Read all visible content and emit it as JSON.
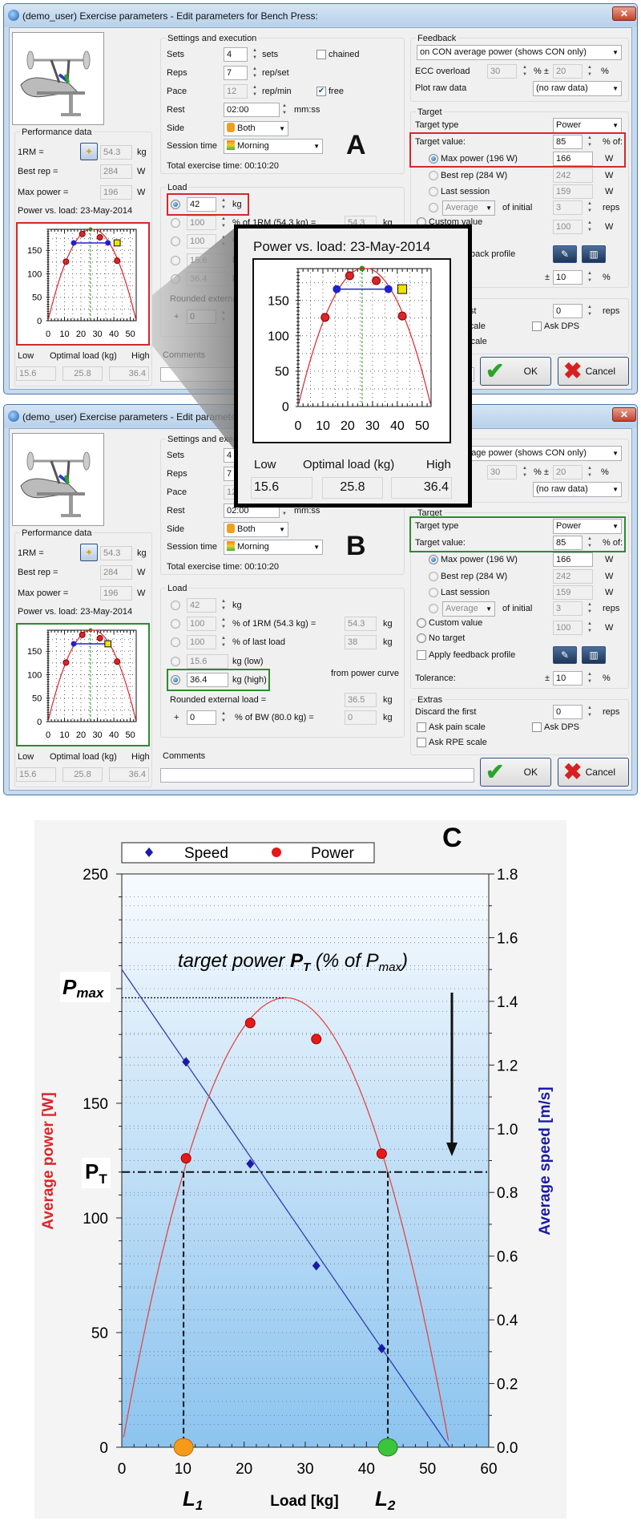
{
  "dialog": {
    "title": "(demo_user) Exercise parameters - Edit parameters for Bench Press:",
    "close_label": "✕",
    "perf": {
      "title": "Performance data",
      "rm_label": "1RM =",
      "rm_value": "54.3",
      "rm_unit": "kg",
      "best_label": "Best rep =",
      "best_value": "284",
      "best_unit": "W",
      "max_label": "Max power =",
      "max_value": "196",
      "max_unit": "W",
      "chart_title": "Power vs. load: 23-May-2014"
    },
    "optimal": {
      "low_label": "Low",
      "opt_label": "Optimal load (kg)",
      "high_label": "High",
      "low": "15.6",
      "opt": "25.8",
      "high": "36.4"
    },
    "settings": {
      "title": "Settings and execution",
      "sets_label": "Sets",
      "sets": "4",
      "sets_unit": "sets",
      "reps_label": "Reps",
      "reps": "7",
      "reps_unit": "rep/set",
      "pace_label": "Pace",
      "pace": "12",
      "pace_unit": "rep/min",
      "chained_label": "chained",
      "chained": false,
      "free_label": "free",
      "free": true,
      "rest_label": "Rest",
      "rest": "02:00",
      "rest_unit": "mm:ss",
      "side_label": "Side",
      "side": "Both",
      "session_label": "Session time",
      "session": "Morning",
      "total": "Total exercise time: 00:10:20"
    },
    "load": {
      "title": "Load",
      "rows": [
        {
          "value": "42",
          "unit": "kg"
        },
        {
          "value": "100",
          "unit": "% of 1RM (54.3 kg) =",
          "result": "54.3",
          "result_unit": "kg"
        },
        {
          "value": "100",
          "unit": "% of last load",
          "result": "38",
          "result_unit": "kg"
        },
        {
          "value": "15.6",
          "unit": "kg (low)"
        },
        {
          "value": "36.4",
          "unit": "kg (high)"
        }
      ],
      "from_curve": "from power curve",
      "rounded_label": "Rounded external load =",
      "rounded": "36.5",
      "rounded_unit": "kg",
      "bw_plus": "+",
      "bw": "0",
      "bw_label": "% of BW (80.0 kg) =",
      "bw_result": "0",
      "bw_unit": "kg"
    },
    "comments_label": "Comments",
    "comments": "",
    "feedback": {
      "title": "Feedback",
      "mode": "on CON average power (shows CON only)",
      "ecc_label": "ECC overload",
      "ecc": "30",
      "ecc_sep": "% ±",
      "ecc_tol": "20",
      "ecc_unit": "%",
      "raw_label": "Plot raw data",
      "raw": "(no raw data)"
    },
    "target": {
      "title": "Target",
      "type_label": "Target type",
      "type": "Power",
      "value_label": "Target value:",
      "value": "85",
      "value_unit": "% of:",
      "options": [
        {
          "label": "Max power (196 W)",
          "value": "166",
          "unit": "W"
        },
        {
          "label": "Best rep (284 W)",
          "value": "242",
          "unit": "W"
        },
        {
          "label": "Last session",
          "value": "159",
          "unit": "W"
        }
      ],
      "avg_mode": "Average",
      "avg_label": "of initial",
      "avg_n": "3",
      "avg_unit": "reps",
      "custom_label": "Custom value",
      "custom": "100",
      "custom_unit": "W",
      "none_label": "No target",
      "apply_label": "Apply feedback profile",
      "tol_label": "Tolerance:",
      "tol_pm": "±",
      "tol": "10",
      "tol_unit": "%"
    },
    "extras": {
      "title": "Extras",
      "discard_label": "Discard the first",
      "discard": "0",
      "discard_unit": "reps",
      "pain_label": "Ask pain scale",
      "dps_label": "Ask DPS",
      "rpe_label": "Ask RPE scale"
    },
    "ok": "OK",
    "cancel": "Cancel"
  },
  "windows": [
    {
      "letter": "A",
      "load_selected": 0,
      "highlight": "target-value",
      "highlight_color": "#d9262b",
      "current_load": 42
    },
    {
      "letter": "B",
      "load_selected": 4,
      "highlight": "target-type",
      "highlight_color": "#2e8b2e",
      "current_load": 36.4
    }
  ],
  "colors": {
    "power": "#d9262b",
    "speed": "#1a1aa8",
    "optimal": "#1f9a1f",
    "band": "#2020d0",
    "current": "#f2e200",
    "l1": "#f59a1b",
    "l2": "#3cc43c"
  },
  "chart_data": [
    {
      "type": "scatter",
      "title": "Power vs. load: 23-May-2014",
      "xlim": [
        0,
        53.6
      ],
      "ylim": [
        0,
        195
      ],
      "x_ticks": [
        0,
        10,
        20,
        30,
        40,
        50
      ],
      "y_ticks": [
        0,
        50,
        100,
        150
      ],
      "grid": true,
      "power_points": [
        [
          10.9,
          126
        ],
        [
          20.8,
          185
        ],
        [
          31.5,
          178
        ],
        [
          42,
          128
        ]
      ],
      "power_fit": {
        "peak_load": 26.8,
        "peak_power": 196,
        "zero_load": 53.6
      },
      "optimal_load": 25.8,
      "target_band": {
        "power": 166,
        "low": 15.6,
        "high": 36.4
      }
    },
    {
      "type": "scatter",
      "panel_label": "C",
      "xlabel": "Load [kg]",
      "ylabel": "Average power [W]",
      "y2label": "Average speed [m/s]",
      "xlim": [
        0,
        60
      ],
      "ylim": [
        0,
        250
      ],
      "y2lim": [
        0,
        1.8
      ],
      "x_ticks": [
        "0",
        "10",
        "20",
        "30",
        "40",
        "50",
        "60"
      ],
      "y_ticks": [
        "0",
        "50",
        "100",
        "150",
        "250"
      ],
      "y2_ticks": [
        "0.0",
        "0.2",
        "0.4",
        "0.6",
        "0.8",
        "1.0",
        "1.2",
        "1.4",
        "1.6",
        "1.8"
      ],
      "legend": "top",
      "grid": true,
      "series": [
        {
          "name": "Speed",
          "axis": "right",
          "x": [
            10.5,
            21,
            31.8,
            42.5
          ],
          "y": [
            1.21,
            0.89,
            0.57,
            0.31
          ]
        },
        {
          "name": "Power",
          "axis": "left",
          "x": [
            10.5,
            21,
            31.8,
            42.5
          ],
          "y": [
            126,
            185,
            178,
            128
          ]
        }
      ],
      "speed_fit": {
        "v0": 1.5,
        "zero_load": 53.6
      },
      "power_fit": {
        "peak_load": 26.8,
        "peak_power": 196,
        "zero_load": 53.6
      },
      "target_power": 120,
      "l1": 10.1,
      "l2": 43.5,
      "annotation": {
        "a": "target power ",
        "p": "P",
        "t": "T",
        "b": " (% of ",
        "max": "max",
        "c": ")"
      },
      "pmax_label": {
        "p": "P",
        "sub": "max"
      },
      "pt_label": {
        "p": "P",
        "sub": "T"
      },
      "l1_label": {
        "l": "L",
        "sub": "1"
      },
      "l2_label": {
        "l": "L",
        "sub": "2"
      }
    }
  ]
}
